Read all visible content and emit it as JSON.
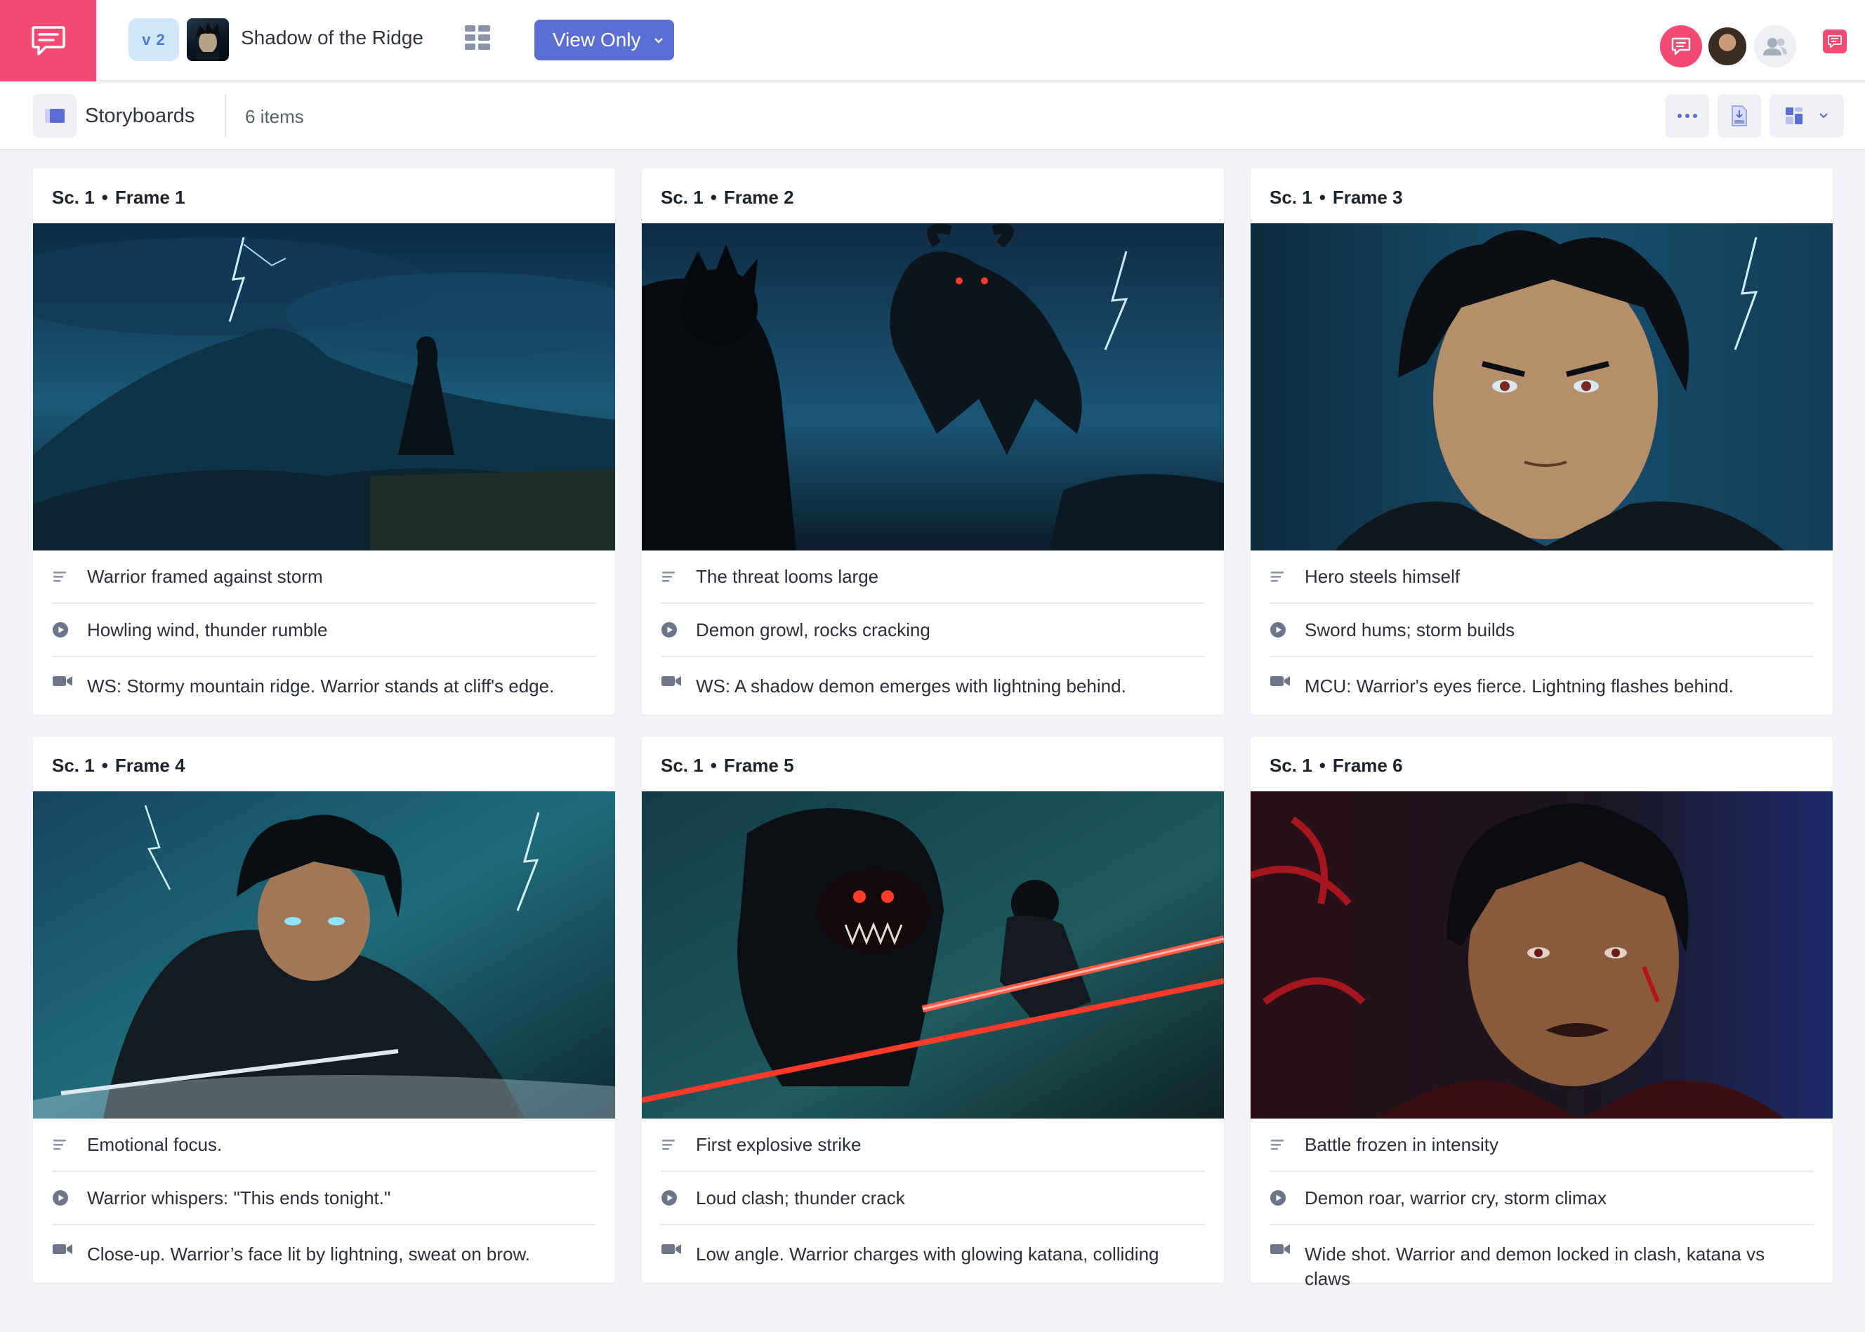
{
  "app": {
    "version": "v 2",
    "project_title": "Shadow of the Ridge",
    "view_mode": "View Only"
  },
  "subbar": {
    "title": "Storyboards",
    "count": "6 items"
  },
  "colors": {
    "brand": "#f24a73",
    "accent": "#5a6ed4",
    "version_bg": "#cfe6fb"
  },
  "frames": [
    {
      "scene": "Sc. 1",
      "frame": "Frame",
      "number": "1",
      "description": "Warrior framed against storm",
      "audio": "Howling wind, thunder rumble",
      "shot": "WS: Stormy mountain ridge. Warrior stands at cliff's edge."
    },
    {
      "scene": "Sc. 1",
      "frame": "Frame",
      "number": "2",
      "description": "The threat looms large",
      "audio": "Demon growl, rocks cracking",
      "shot": "WS: A shadow demon emerges with lightning behind."
    },
    {
      "scene": "Sc. 1",
      "frame": "Frame",
      "number": "3",
      "description": "Hero steels himself",
      "audio": "Sword hums; storm builds",
      "shot": "MCU: Warrior's eyes fierce. Lightning flashes behind."
    },
    {
      "scene": "Sc. 1",
      "frame": "Frame",
      "number": "4",
      "description": "Emotional focus.",
      "audio": "Warrior whispers: \"This ends tonight.\"",
      "shot": "Close-up. Warrior’s face lit by lightning, sweat on brow."
    },
    {
      "scene": "Sc. 1",
      "frame": "Frame",
      "number": "5",
      "description": "First explosive strike",
      "audio": "Loud clash; thunder crack",
      "shot": "Low angle. Warrior charges with glowing katana, colliding"
    },
    {
      "scene": "Sc. 1",
      "frame": "Frame",
      "number": "6",
      "description": "Battle frozen in intensity",
      "audio": "Demon roar, warrior cry, storm climax",
      "shot": "Wide shot. Warrior and demon locked in clash, katana vs claws"
    }
  ]
}
